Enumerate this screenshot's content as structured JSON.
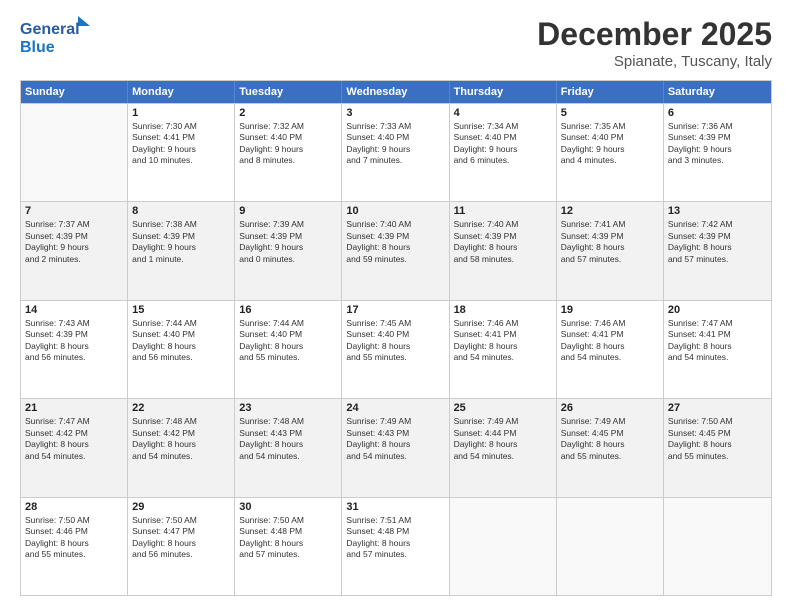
{
  "logo": {
    "line1": "General",
    "line2": "Blue"
  },
  "header": {
    "month": "December 2025",
    "location": "Spianate, Tuscany, Italy"
  },
  "weekdays": [
    "Sunday",
    "Monday",
    "Tuesday",
    "Wednesday",
    "Thursday",
    "Friday",
    "Saturday"
  ],
  "rows": [
    [
      {
        "day": "",
        "text": ""
      },
      {
        "day": "1",
        "text": "Sunrise: 7:30 AM\nSunset: 4:41 PM\nDaylight: 9 hours\nand 10 minutes."
      },
      {
        "day": "2",
        "text": "Sunrise: 7:32 AM\nSunset: 4:40 PM\nDaylight: 9 hours\nand 8 minutes."
      },
      {
        "day": "3",
        "text": "Sunrise: 7:33 AM\nSunset: 4:40 PM\nDaylight: 9 hours\nand 7 minutes."
      },
      {
        "day": "4",
        "text": "Sunrise: 7:34 AM\nSunset: 4:40 PM\nDaylight: 9 hours\nand 6 minutes."
      },
      {
        "day": "5",
        "text": "Sunrise: 7:35 AM\nSunset: 4:40 PM\nDaylight: 9 hours\nand 4 minutes."
      },
      {
        "day": "6",
        "text": "Sunrise: 7:36 AM\nSunset: 4:39 PM\nDaylight: 9 hours\nand 3 minutes."
      }
    ],
    [
      {
        "day": "7",
        "text": "Sunrise: 7:37 AM\nSunset: 4:39 PM\nDaylight: 9 hours\nand 2 minutes."
      },
      {
        "day": "8",
        "text": "Sunrise: 7:38 AM\nSunset: 4:39 PM\nDaylight: 9 hours\nand 1 minute."
      },
      {
        "day": "9",
        "text": "Sunrise: 7:39 AM\nSunset: 4:39 PM\nDaylight: 9 hours\nand 0 minutes."
      },
      {
        "day": "10",
        "text": "Sunrise: 7:40 AM\nSunset: 4:39 PM\nDaylight: 8 hours\nand 59 minutes."
      },
      {
        "day": "11",
        "text": "Sunrise: 7:40 AM\nSunset: 4:39 PM\nDaylight: 8 hours\nand 58 minutes."
      },
      {
        "day": "12",
        "text": "Sunrise: 7:41 AM\nSunset: 4:39 PM\nDaylight: 8 hours\nand 57 minutes."
      },
      {
        "day": "13",
        "text": "Sunrise: 7:42 AM\nSunset: 4:39 PM\nDaylight: 8 hours\nand 57 minutes."
      }
    ],
    [
      {
        "day": "14",
        "text": "Sunrise: 7:43 AM\nSunset: 4:39 PM\nDaylight: 8 hours\nand 56 minutes."
      },
      {
        "day": "15",
        "text": "Sunrise: 7:44 AM\nSunset: 4:40 PM\nDaylight: 8 hours\nand 56 minutes."
      },
      {
        "day": "16",
        "text": "Sunrise: 7:44 AM\nSunset: 4:40 PM\nDaylight: 8 hours\nand 55 minutes."
      },
      {
        "day": "17",
        "text": "Sunrise: 7:45 AM\nSunset: 4:40 PM\nDaylight: 8 hours\nand 55 minutes."
      },
      {
        "day": "18",
        "text": "Sunrise: 7:46 AM\nSunset: 4:41 PM\nDaylight: 8 hours\nand 54 minutes."
      },
      {
        "day": "19",
        "text": "Sunrise: 7:46 AM\nSunset: 4:41 PM\nDaylight: 8 hours\nand 54 minutes."
      },
      {
        "day": "20",
        "text": "Sunrise: 7:47 AM\nSunset: 4:41 PM\nDaylight: 8 hours\nand 54 minutes."
      }
    ],
    [
      {
        "day": "21",
        "text": "Sunrise: 7:47 AM\nSunset: 4:42 PM\nDaylight: 8 hours\nand 54 minutes."
      },
      {
        "day": "22",
        "text": "Sunrise: 7:48 AM\nSunset: 4:42 PM\nDaylight: 8 hours\nand 54 minutes."
      },
      {
        "day": "23",
        "text": "Sunrise: 7:48 AM\nSunset: 4:43 PM\nDaylight: 8 hours\nand 54 minutes."
      },
      {
        "day": "24",
        "text": "Sunrise: 7:49 AM\nSunset: 4:43 PM\nDaylight: 8 hours\nand 54 minutes."
      },
      {
        "day": "25",
        "text": "Sunrise: 7:49 AM\nSunset: 4:44 PM\nDaylight: 8 hours\nand 54 minutes."
      },
      {
        "day": "26",
        "text": "Sunrise: 7:49 AM\nSunset: 4:45 PM\nDaylight: 8 hours\nand 55 minutes."
      },
      {
        "day": "27",
        "text": "Sunrise: 7:50 AM\nSunset: 4:45 PM\nDaylight: 8 hours\nand 55 minutes."
      }
    ],
    [
      {
        "day": "28",
        "text": "Sunrise: 7:50 AM\nSunset: 4:46 PM\nDaylight: 8 hours\nand 55 minutes."
      },
      {
        "day": "29",
        "text": "Sunrise: 7:50 AM\nSunset: 4:47 PM\nDaylight: 8 hours\nand 56 minutes."
      },
      {
        "day": "30",
        "text": "Sunrise: 7:50 AM\nSunset: 4:48 PM\nDaylight: 8 hours\nand 57 minutes."
      },
      {
        "day": "31",
        "text": "Sunrise: 7:51 AM\nSunset: 4:48 PM\nDaylight: 8 hours\nand 57 minutes."
      },
      {
        "day": "",
        "text": ""
      },
      {
        "day": "",
        "text": ""
      },
      {
        "day": "",
        "text": ""
      }
    ]
  ]
}
